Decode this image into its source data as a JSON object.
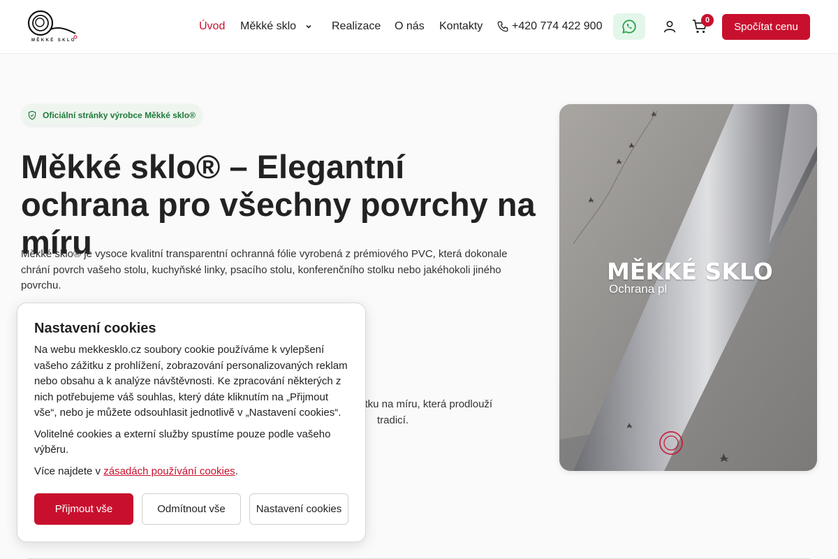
{
  "header": {
    "logo_text": "MĚKKÉ SKLO",
    "nav": [
      {
        "label": "Úvod",
        "active": true
      },
      {
        "label": "Měkké sklo",
        "has_dropdown": true
      },
      {
        "label": "Realizace"
      },
      {
        "label": "O nás"
      },
      {
        "label": "Kontakty"
      }
    ],
    "phone": "+420 774 422 900",
    "cart_count": "0",
    "cta_label": "Spočítat cenu"
  },
  "hero": {
    "badge": "Oficiální stránky výrobce Měkké sklo®",
    "title": "Měkké sklo® – Elegantní ochrana pro všechny povrchy na míru",
    "description": "Měkké sklo® je vysoce kvalitní transparentní ochranná fólie vyrobená z prémiového PVC, která dokonale chrání povrch vašeho stolu, kuchyňské linky, psacího stolu, konferenčního stolku nebo jakéhokoli jiného povrchu.",
    "description2_line1": "ytku na míru, která prodlouží",
    "description2_line2": "tradicí.",
    "image_title": "MĚKKÉ SKLO",
    "image_subtitle": "Ochrana pl"
  },
  "cookie": {
    "title": "Nastavení cookies",
    "text1": "Na webu mekkesklo.cz soubory cookie používáme k vylepšení vašeho zážitku z prohlížení, zobrazování personalizovaných reklam nebo obsahu a k analýze návštěvnosti. Ke zpracování některých z nich potřebujeme váš souhlas, který dáte kliknutím na „Přijmout vše“, nebo je můžete odsouhlasit jednotlivě v „Nastavení cookies“.",
    "text2": "Volitelné cookies a externí služby spustíme pouze podle vašeho výběru.",
    "text3_prefix": "Více najdete v ",
    "text3_link": "zásadách používání cookies",
    "text3_suffix": ".",
    "accept_label": "Přijmout vše",
    "reject_label": "Odmítnout vše",
    "settings_label": "Nastavení cookies"
  },
  "colors": {
    "brand_red": "#c8102e",
    "badge_green": "#1f7a3a",
    "whatsapp_green": "#25a244"
  }
}
